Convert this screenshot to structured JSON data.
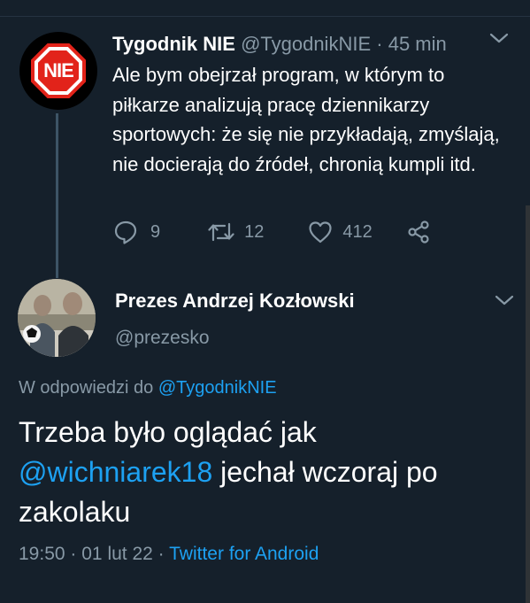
{
  "parent_tweet": {
    "avatar_text": "NIE",
    "display_name": "Tygodnik NIE",
    "handle": "@TygodnikNIE",
    "separator": "·",
    "time": "45 min",
    "text": "Ale bym obejrzał program, w którym to piłkarze analizują pracę dziennikarzy sportowych: że się nie przykładają, zmyślają, nie docierają do źródeł, chronią kumpli itd.",
    "replies": "9",
    "retweets": "12",
    "likes": "412"
  },
  "main_tweet": {
    "display_name": "Prezes Andrzej Kozłowski",
    "handle": "@prezesko",
    "reply_prefix": "W odpowiedzi do",
    "reply_handle": "@TygodnikNIE",
    "text_part1": "Trzeba było oglądać jak",
    "mention": "@wichniarek18",
    "text_part2": "jechał wczoraj po zakolaku",
    "time": "19:50",
    "date": "01 lut 22",
    "separator": "·",
    "source": "Twitter for Android"
  },
  "icons": [
    "nie-stop-sign-logo",
    "chevron-down-icon",
    "reply-icon",
    "retweet-icon",
    "like-icon",
    "share-icon",
    "avatar-photo"
  ],
  "colors": {
    "background": "#15202b",
    "accent": "#1da1f2",
    "muted": "#8899a6",
    "logo_red": "#e2231a"
  }
}
